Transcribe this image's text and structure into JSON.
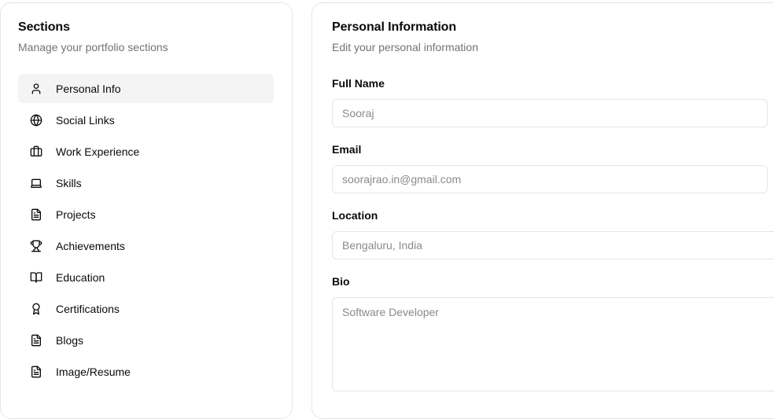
{
  "sidebar": {
    "title": "Sections",
    "subtitle": "Manage your portfolio sections",
    "items": [
      {
        "label": "Personal Info",
        "icon": "user-icon"
      },
      {
        "label": "Social Links",
        "icon": "globe-icon"
      },
      {
        "label": "Work Experience",
        "icon": "briefcase-icon"
      },
      {
        "label": "Skills",
        "icon": "laptop-icon"
      },
      {
        "label": "Projects",
        "icon": "file-text-icon"
      },
      {
        "label": "Achievements",
        "icon": "trophy-icon"
      },
      {
        "label": "Education",
        "icon": "book-open-icon"
      },
      {
        "label": "Certifications",
        "icon": "award-icon"
      },
      {
        "label": "Blogs",
        "icon": "file-text-icon"
      },
      {
        "label": "Image/Resume",
        "icon": "file-text-icon"
      }
    ],
    "active_index": 0
  },
  "main": {
    "title": "Personal Information",
    "subtitle": "Edit your personal information",
    "fields": {
      "full_name": {
        "label": "Full Name",
        "placeholder": "Sooraj"
      },
      "email": {
        "label": "Email",
        "placeholder": "soorajrao.in@gmail.com"
      },
      "location": {
        "label": "Location",
        "placeholder": "Bengaluru, India"
      },
      "bio": {
        "label": "Bio",
        "placeholder": "Software Developer"
      }
    }
  },
  "colors": {
    "border": "#e5e5e5",
    "muted_text": "#737373",
    "active_bg": "#f4f4f5",
    "text": "#0a0a0a"
  }
}
